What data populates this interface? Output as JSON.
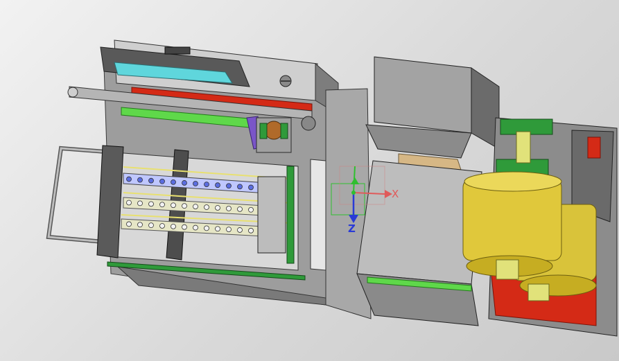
{
  "axis_labels": {
    "x": "X",
    "z": "Z"
  },
  "colors": {
    "background": "#d9d9d9",
    "frame_gray": "#a8a8a8",
    "panel_light": "#c8c8c8",
    "panel_dark": "#6e6e6e",
    "accent_red": "#d42a16",
    "accent_green": "#2f9a3a",
    "bright_green": "#5fd84a",
    "roller_yellow": "#d9c33a",
    "glass_cyan": "#5fd6dc",
    "purple": "#7a55c8",
    "axis_x": "#e05a5a",
    "axis_y": "#2fbf2f",
    "axis_z": "#2a3bd6"
  }
}
